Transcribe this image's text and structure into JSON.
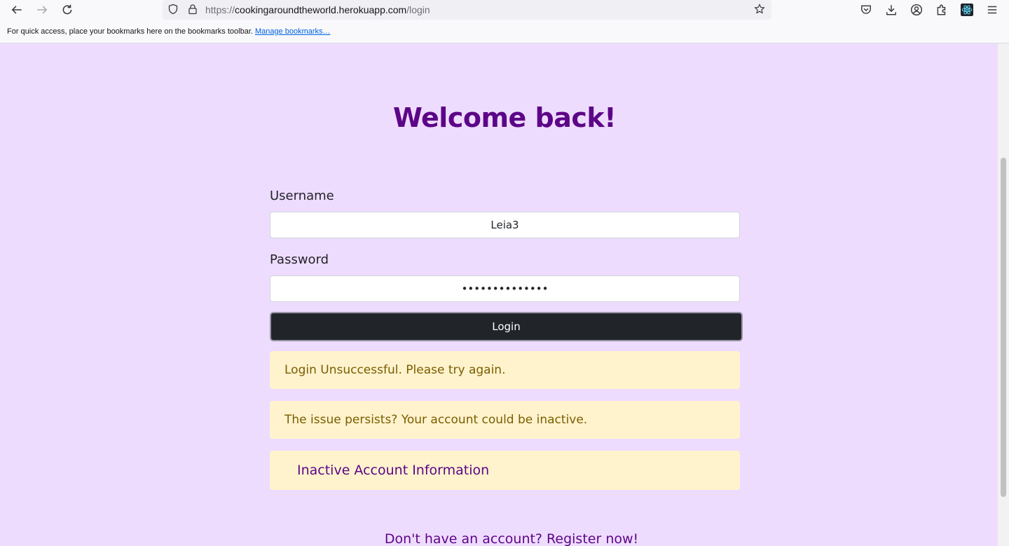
{
  "browser": {
    "url_prefix": "https://",
    "url_host": "cookingaroundtheworld.herokuapp.com",
    "url_path": "/login",
    "bookmarks_message": "For quick access, place your bookmarks here on the bookmarks toolbar.",
    "bookmarks_link": "Manage bookmarks…"
  },
  "login": {
    "title": "Welcome back!",
    "username_label": "Username",
    "username_value": "Leia3",
    "password_label": "Password",
    "password_value": "••••••••••••••",
    "login_button": "Login"
  },
  "alerts": {
    "unsuccessful": "Login Unsuccessful. Please try again.",
    "inactive": "The issue persists? Your account could be inactive.",
    "info_link": "Inactive Account Information"
  },
  "register_link": "Don't have an account? Register now!",
  "colors": {
    "page_background": "#eedcff",
    "accent": "#5c0587",
    "alert_background": "#fff3cd",
    "alert_text": "#7a5d00",
    "button_background": "#212529"
  }
}
